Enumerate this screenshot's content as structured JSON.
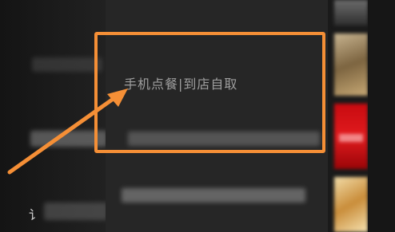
{
  "menu": {
    "order_item_label": "手机点餐|到店自取"
  },
  "partial_text": {
    "left_glyph": "讠"
  },
  "annotation": {
    "color": "#f58f36"
  },
  "icons": [
    "arrow-icon"
  ]
}
